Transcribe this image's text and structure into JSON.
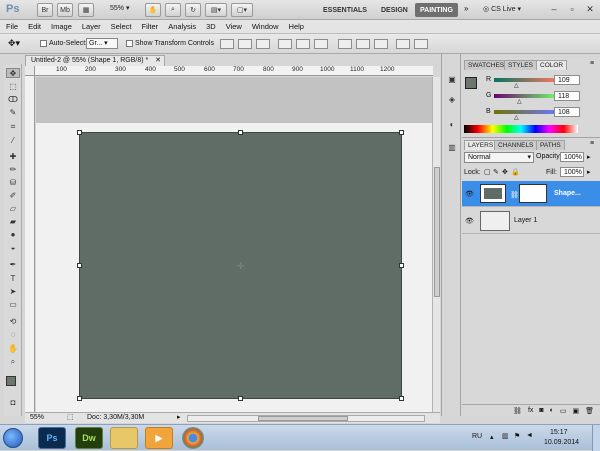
{
  "app": {
    "logo": "Ps",
    "br_label": "Br",
    "mb_label": "Mb",
    "zoom": "55%",
    "workspaces": [
      "ESSENTIALS",
      "DESIGN",
      "PAINTING"
    ],
    "active_workspace": "PAINTING",
    "cs_live": "CS Live"
  },
  "menu": [
    "File",
    "Edit",
    "Image",
    "Layer",
    "Select",
    "Filter",
    "Analysis",
    "3D",
    "View",
    "Window",
    "Help"
  ],
  "options": {
    "auto_select_label": "Auto-Select:",
    "auto_select_value": "Gr...",
    "show_transform_label": "Show Transform Controls"
  },
  "document": {
    "tab_title": "Untitled-2 @ 55% (Shape 1, RGB/8) *",
    "ruler_ticks": [
      "100",
      "200",
      "300",
      "400",
      "500",
      "600",
      "700",
      "800",
      "900",
      "1000",
      "1100",
      "1200"
    ],
    "status_zoom": "55%",
    "status_doc": "Doc: 3,30M/3,30M"
  },
  "color_panel": {
    "tabs": [
      "SWATCHES",
      "STYLES",
      "COLOR"
    ],
    "active_tab": "COLOR",
    "r_label": "R",
    "g_label": "G",
    "b_label": "B",
    "r": "109",
    "g": "118",
    "b": "108",
    "foreground": "#6d766c"
  },
  "layers_panel": {
    "tabs": [
      "LAYERS",
      "CHANNELS",
      "PATHS"
    ],
    "active_tab": "LAYERS",
    "blend_mode": "Normal",
    "opacity_label": "Opacity:",
    "opacity": "100%",
    "lock_label": "Lock:",
    "fill_label": "Fill:",
    "fill": "100%",
    "layers": [
      {
        "name": "Shape...",
        "selected": true
      },
      {
        "name": "Layer 1",
        "selected": false
      }
    ]
  },
  "taskbar": {
    "apps": [
      "Ps",
      "Dw"
    ],
    "language": "RU",
    "time": "15:17",
    "date": "10.09.2014"
  },
  "colors": {
    "shape_fill": "#5f6d66",
    "selected_layer": "#3b8ee8",
    "taskbar": "#b8cce2"
  }
}
